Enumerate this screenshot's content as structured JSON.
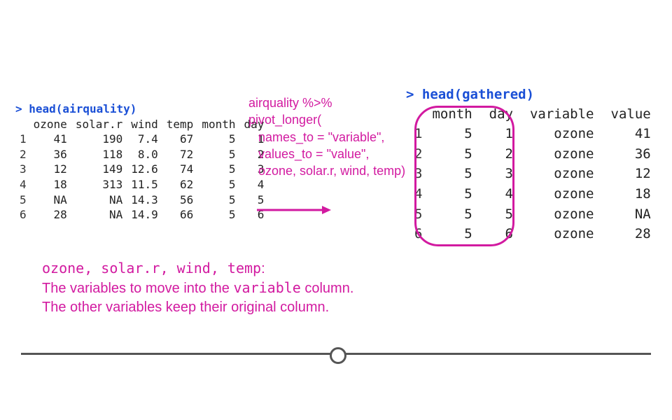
{
  "left": {
    "prompt": "> ",
    "fn": "head(airquality)",
    "headers": [
      "ozone",
      "solar.r",
      "wind",
      "temp",
      "month",
      "day"
    ],
    "rows": [
      {
        "i": "1",
        "ozone": "41",
        "solar": "190",
        "wind": "7.4",
        "temp": "67",
        "month": "5",
        "day": "1"
      },
      {
        "i": "2",
        "ozone": "36",
        "solar": "118",
        "wind": "8.0",
        "temp": "72",
        "month": "5",
        "day": "2"
      },
      {
        "i": "3",
        "ozone": "12",
        "solar": "149",
        "wind": "12.6",
        "temp": "74",
        "month": "5",
        "day": "3"
      },
      {
        "i": "4",
        "ozone": "18",
        "solar": "313",
        "wind": "11.5",
        "temp": "62",
        "month": "5",
        "day": "4"
      },
      {
        "i": "5",
        "ozone": "NA",
        "solar": "NA",
        "wind": "14.3",
        "temp": "56",
        "month": "5",
        "day": "5"
      },
      {
        "i": "6",
        "ozone": "28",
        "solar": "NA",
        "wind": "14.9",
        "temp": "66",
        "month": "5",
        "day": "6"
      }
    ]
  },
  "mid": {
    "l1": "airquality %>%",
    "l2": "pivot_longer(",
    "l3": "names_to = \"variable\",",
    "l4": "values_to = \"value\",",
    "l5": "ozone, solar.r, wind, temp)"
  },
  "right": {
    "prompt": "> ",
    "fn": "head(gathered)",
    "headers": [
      "month",
      "day",
      "variable",
      "value"
    ],
    "rows": [
      {
        "i": "1",
        "month": "5",
        "day": "1",
        "variable": "ozone",
        "value": "41"
      },
      {
        "i": "2",
        "month": "5",
        "day": "2",
        "variable": "ozone",
        "value": "36"
      },
      {
        "i": "3",
        "month": "5",
        "day": "3",
        "variable": "ozone",
        "value": "12"
      },
      {
        "i": "4",
        "month": "5",
        "day": "4",
        "variable": "ozone",
        "value": "18"
      },
      {
        "i": "5",
        "month": "5",
        "day": "5",
        "variable": "ozone",
        "value": "NA"
      },
      {
        "i": "6",
        "month": "5",
        "day": "6",
        "variable": "ozone",
        "value": "28"
      }
    ]
  },
  "explain": {
    "code": "ozone, solar.r, wind, temp",
    "colon": ":",
    "l2a": "The variables to move into the ",
    "l2b": "variable",
    "l2c": " column.",
    "l3": "The other variables keep their original column."
  },
  "colors": {
    "accent": "#d21aa0",
    "blue": "#1a4fd6"
  }
}
